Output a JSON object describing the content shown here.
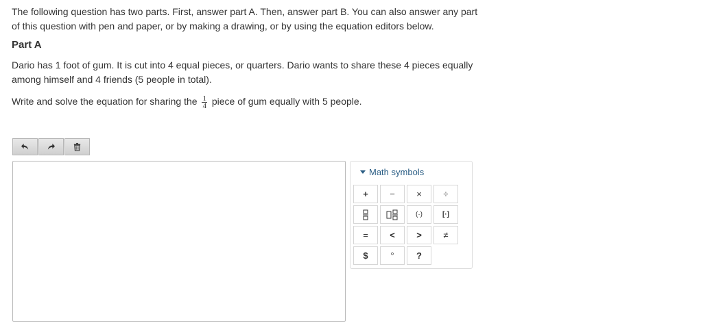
{
  "intro": "The following question has two parts. First, answer part A. Then, answer part B. You can also answer any part of this question with pen and paper, or by making a drawing, or by using the equation editors below.",
  "part_title": "Part A",
  "problem": "Dario has 1 foot of gum. It is cut into 4 equal pieces, or quarters. Dario wants to share these 4 pieces equally among himself and 4 friends (5 people in total).",
  "instruction": {
    "before": "Write and solve the equation for sharing the",
    "frac_num": "1",
    "frac_den": "4",
    "after": "piece of gum equally with 5 people."
  },
  "toolbar": {
    "undo_icon": "undo-icon",
    "redo_icon": "redo-icon",
    "delete_icon": "trash-icon"
  },
  "palette": {
    "header": "Math symbols",
    "symbols": {
      "plus": "+",
      "minus": "−",
      "times": "×",
      "divide": "÷",
      "fraction": "fraction-icon",
      "mixed_number": "mixed-number-icon",
      "parentheses": "(·)",
      "brackets": "[·]",
      "equals": "=",
      "less_than": "<",
      "greater_than": ">",
      "not_equal": "≠",
      "dollar": "$",
      "degree": "°",
      "question": "?"
    }
  },
  "colors": {
    "text": "#333333",
    "link": "#2a5d84",
    "border": "#b9b9b9"
  }
}
